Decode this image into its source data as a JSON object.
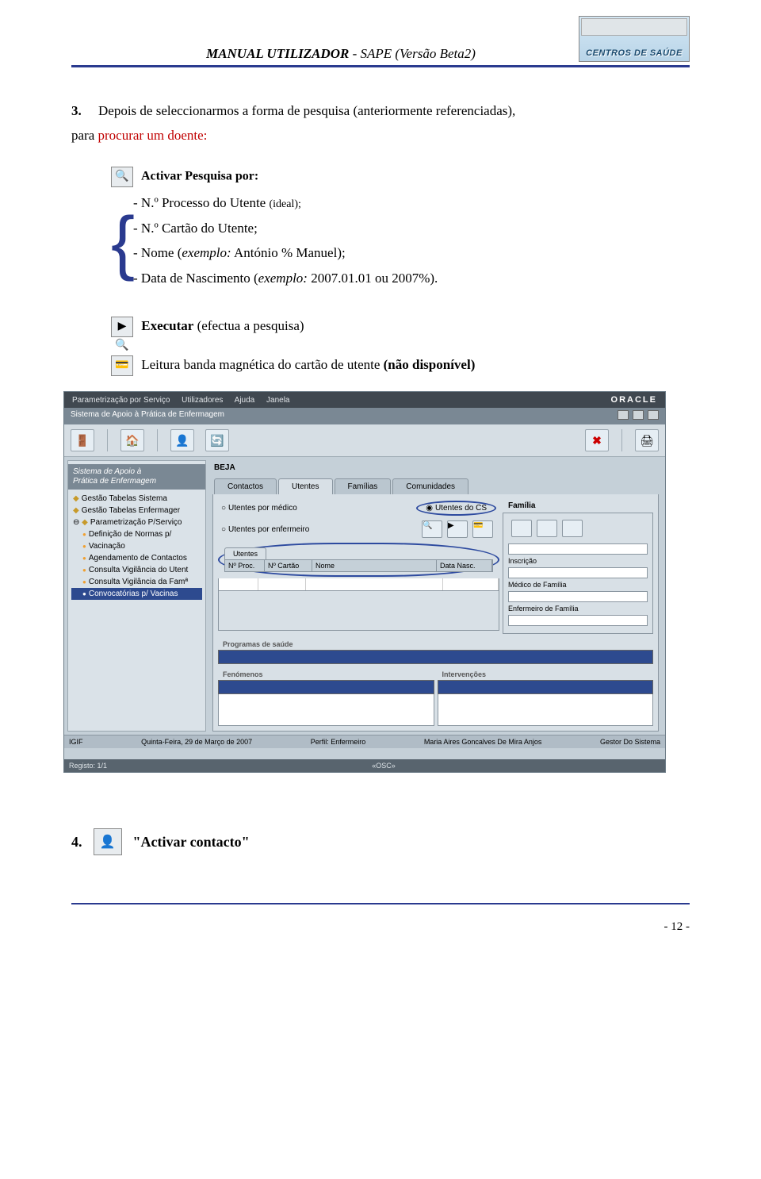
{
  "header": {
    "title_bold": "MANUAL UTILIZADOR",
    "title_rest": " - SAPE (Versão Beta2)",
    "logo_text": "CENTROS DE SAÚDE"
  },
  "step3": {
    "num": "3.",
    "line1a": "Depois de seleccionarmos a forma de pesquisa (anteriormente referenciadas),",
    "line2a": "para ",
    "line2red": "procurar um doente:"
  },
  "activar": {
    "title": "Activar Pesquisa por:",
    "item1": "- N.º Processo do Utente ",
    "item1_small": "(ideal);",
    "item2": "- N.º Cartão do Utente;",
    "item3a": "- Nome (",
    "item3i": "exemplo:",
    "item3b": " António % Manuel);",
    "item4a": "- Data de Nascimento (",
    "item4i": "exemplo:",
    "item4b": " 2007.01.01 ou 2007%)."
  },
  "executar": {
    "bold": "Executar",
    "rest": " (efectua a pesquisa)"
  },
  "leitura": {
    "text": "Leitura banda magnética do cartão de utente ",
    "bold": "(não disponível)"
  },
  "screenshot": {
    "menu": {
      "m1": "Parametrização por Serviço",
      "m2": "Utilizadores",
      "m3": "Ajuda",
      "m4": "Janela",
      "oracle": "ORACLE"
    },
    "title": "Sistema de Apoio à Prática de Enfermagem",
    "left_head1": "Sistema de Apoio à",
    "left_head2": "Prática de Enfermagem",
    "tree": {
      "t1": "Gestão Tabelas Sistema",
      "t2": "Gestão Tabelas Enfermager",
      "t3": "Parametrização P/Serviço",
      "t4": "Definição de Normas p/",
      "t5": "Vacinação",
      "t6": "Agendamento de Contactos",
      "t7": "Consulta Vigilância do Utent",
      "t8": "Consulta Vigilância da Famª",
      "t9": "Convocatórias p/ Vacinas"
    },
    "beja": "BEJA",
    "tabs": {
      "t1": "Contactos",
      "t2": "Utentes",
      "t3": "Famílias",
      "t4": "Comunidades"
    },
    "radios": {
      "r1": "Utentes por médico",
      "r2": "Utentes por enfermeiro",
      "r3": "Utentes do CS"
    },
    "subtab": "Utentes",
    "cols": {
      "c1": "Nº Proc.",
      "c2": "Nº Cartão",
      "c3": "Nome",
      "c4": "Data Nasc."
    },
    "familia": {
      "title": "Família",
      "f1": "Inscrição",
      "f2": "Médico de Família",
      "f3": "Enfermeiro de Família"
    },
    "progs": "Programas de saúde",
    "fenom": "Fenómenos",
    "interv": "Intervenções",
    "status": {
      "s1": "IGIF",
      "s2": "Quinta-Feira, 29 de Março de 2007",
      "s3": "Perfil: Enfermeiro",
      "s4": "Maria Aires Goncalves De Mira Anjos",
      "s5": "Gestor Do Sistema"
    },
    "status2": {
      "s1": "Registo: 1/1",
      "s2": "«OSC»"
    }
  },
  "step4": {
    "num": "4.",
    "text": "\"Activar contacto\""
  },
  "pagenum": "- 12 -"
}
